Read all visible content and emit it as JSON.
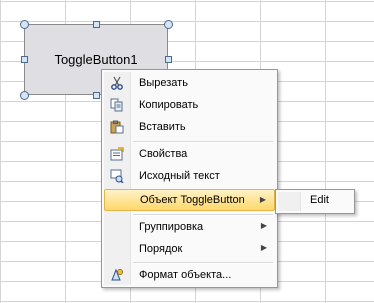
{
  "control": {
    "caption": "ToggleButton1"
  },
  "context_menu": {
    "items": [
      {
        "label": "Вырезать",
        "icon": "scissors-icon"
      },
      {
        "label": "Копировать",
        "icon": "copy-icon"
      },
      {
        "label": "Вставить",
        "icon": "paste-icon"
      },
      {
        "label": "Свойства",
        "icon": "properties-icon"
      },
      {
        "label": "Исходный текст",
        "icon": "view-code-icon"
      },
      {
        "label": "Объект ToggleButton",
        "icon": "",
        "submenu": true,
        "highlighted": true
      },
      {
        "label": "Группировка",
        "icon": "",
        "submenu": true
      },
      {
        "label": "Порядок",
        "icon": "",
        "submenu": true
      },
      {
        "label": "Формат объекта...",
        "icon": "format-object-icon"
      }
    ]
  },
  "submenu": {
    "items": [
      {
        "label": "Edit"
      }
    ]
  },
  "colors": {
    "highlight_top": "#fff2c8",
    "highlight_bottom": "#ffd86b",
    "control_fill": "#dedee3",
    "grid_line": "#d4d4d4"
  }
}
